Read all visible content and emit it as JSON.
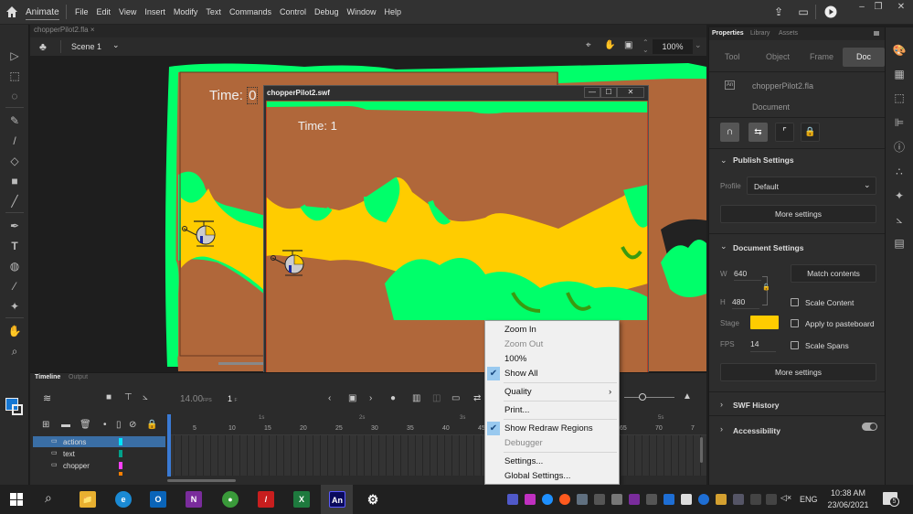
{
  "app": {
    "name": "Animate",
    "menus": [
      "File",
      "Edit",
      "View",
      "Insert",
      "Modify",
      "Text",
      "Commands",
      "Control",
      "Debug",
      "Window",
      "Help"
    ],
    "window_controls": {
      "minimize": "–",
      "restore": "❐",
      "close": "✕"
    }
  },
  "document": {
    "tab_label": "chopperPilot2.fla",
    "tab_close": "×",
    "scene": "Scene 1",
    "zoom": "100%"
  },
  "stage": {
    "time_label": "Time:",
    "time_value": "0",
    "colors": {
      "ground": "#b0673a",
      "grass": "#00ff6a",
      "dark_grass": "#3a9a10",
      "cave": "#ffcc00",
      "pasteboard": "#1e1e1e"
    }
  },
  "swf_window": {
    "title": "chopperPilot2.swf",
    "time_label": "Time:",
    "time_value": "1",
    "controls": {
      "minimize": "—",
      "maximize": "☐",
      "close": "✕"
    }
  },
  "context_menu": {
    "items": [
      {
        "label": "Zoom In",
        "enabled": true,
        "checked": false
      },
      {
        "label": "Zoom Out",
        "enabled": false,
        "checked": false
      },
      {
        "label": "100%",
        "enabled": true,
        "checked": false
      },
      {
        "label": "Show All",
        "enabled": true,
        "checked": true
      },
      {
        "label": "Quality",
        "enabled": true,
        "checked": false,
        "submenu": true
      },
      {
        "label": "Print...",
        "enabled": true,
        "checked": false
      },
      {
        "label": "Show Redraw Regions",
        "enabled": true,
        "checked": true
      },
      {
        "label": "Debugger",
        "enabled": false,
        "checked": false
      },
      {
        "label": "Settings...",
        "enabled": true,
        "checked": false
      },
      {
        "label": "Global Settings...",
        "enabled": true,
        "checked": false
      }
    ],
    "submenu_arrow": "›",
    "check": "✔"
  },
  "properties": {
    "tabs": [
      "Properties",
      "Library",
      "Assets"
    ],
    "subtabs": [
      "Tool",
      "Object",
      "Frame",
      "Doc"
    ],
    "active_subtab": "Doc",
    "doc_icon": "An",
    "file_name": "chopperPilot2.fla",
    "doc_type": "Document",
    "publish": {
      "header": "Publish Settings",
      "profile_label": "Profile",
      "profile_value": "Default",
      "more_settings": "More settings"
    },
    "doc_settings": {
      "header": "Document Settings",
      "w_label": "W",
      "w_value": "640",
      "h_label": "H",
      "h_value": "480",
      "match_contents": "Match contents",
      "scale_content": "Scale Content",
      "stage_label": "Stage",
      "stage_color": "#ffcc00",
      "apply_pasteboard": "Apply to pasteboard",
      "fps_label": "FPS",
      "fps_value": "14",
      "scale_spans": "Scale Spans",
      "more_settings": "More settings"
    },
    "swf_history": "SWF History",
    "accessibility": "Accessibility"
  },
  "timeline": {
    "tabs": [
      "Timeline",
      "Output"
    ],
    "fps": "14.00",
    "fps_unit": "FPS",
    "frame": "1",
    "frame_unit": "F",
    "second_markers": [
      "1s",
      "2s",
      "3s",
      "5s"
    ],
    "frame_numbers": [
      "5",
      "10",
      "15",
      "20",
      "25",
      "30",
      "35",
      "40",
      "45",
      "65",
      "70",
      "7"
    ],
    "layers": [
      {
        "name": "actions",
        "color": "#00e5ff",
        "selected": true
      },
      {
        "name": "text",
        "color": "#00a08a",
        "selected": false
      },
      {
        "name": "chopper",
        "color": "#ff40ff",
        "selected": false
      },
      {
        "name": "",
        "color": "#ff8000",
        "selected": false
      }
    ]
  },
  "taskbar": {
    "apps": [
      {
        "name": "File Explorer",
        "glyph": "📁",
        "bg": "#e8b030"
      },
      {
        "name": "Edge",
        "glyph": "e",
        "bg": "#1a8ad4"
      },
      {
        "name": "Outlook",
        "glyph": "O",
        "bg": "#0a64b8"
      },
      {
        "name": "OneNote",
        "glyph": "N",
        "bg": "#7a2c9c"
      },
      {
        "name": "Chrome",
        "glyph": "●",
        "bg": "#3a9a3a"
      },
      {
        "name": "Acrobat",
        "glyph": "/",
        "bg": "#c81e1e"
      },
      {
        "name": "Excel",
        "glyph": "X",
        "bg": "#1e7a3e"
      },
      {
        "name": "Animate",
        "glyph": "An",
        "bg": "#0a0a5c"
      },
      {
        "name": "Settings",
        "glyph": "⚙",
        "bg": "transparent"
      }
    ],
    "lang": "ENG",
    "time": "10:38 AM",
    "date": "23/06/2021",
    "notifications": "5"
  }
}
